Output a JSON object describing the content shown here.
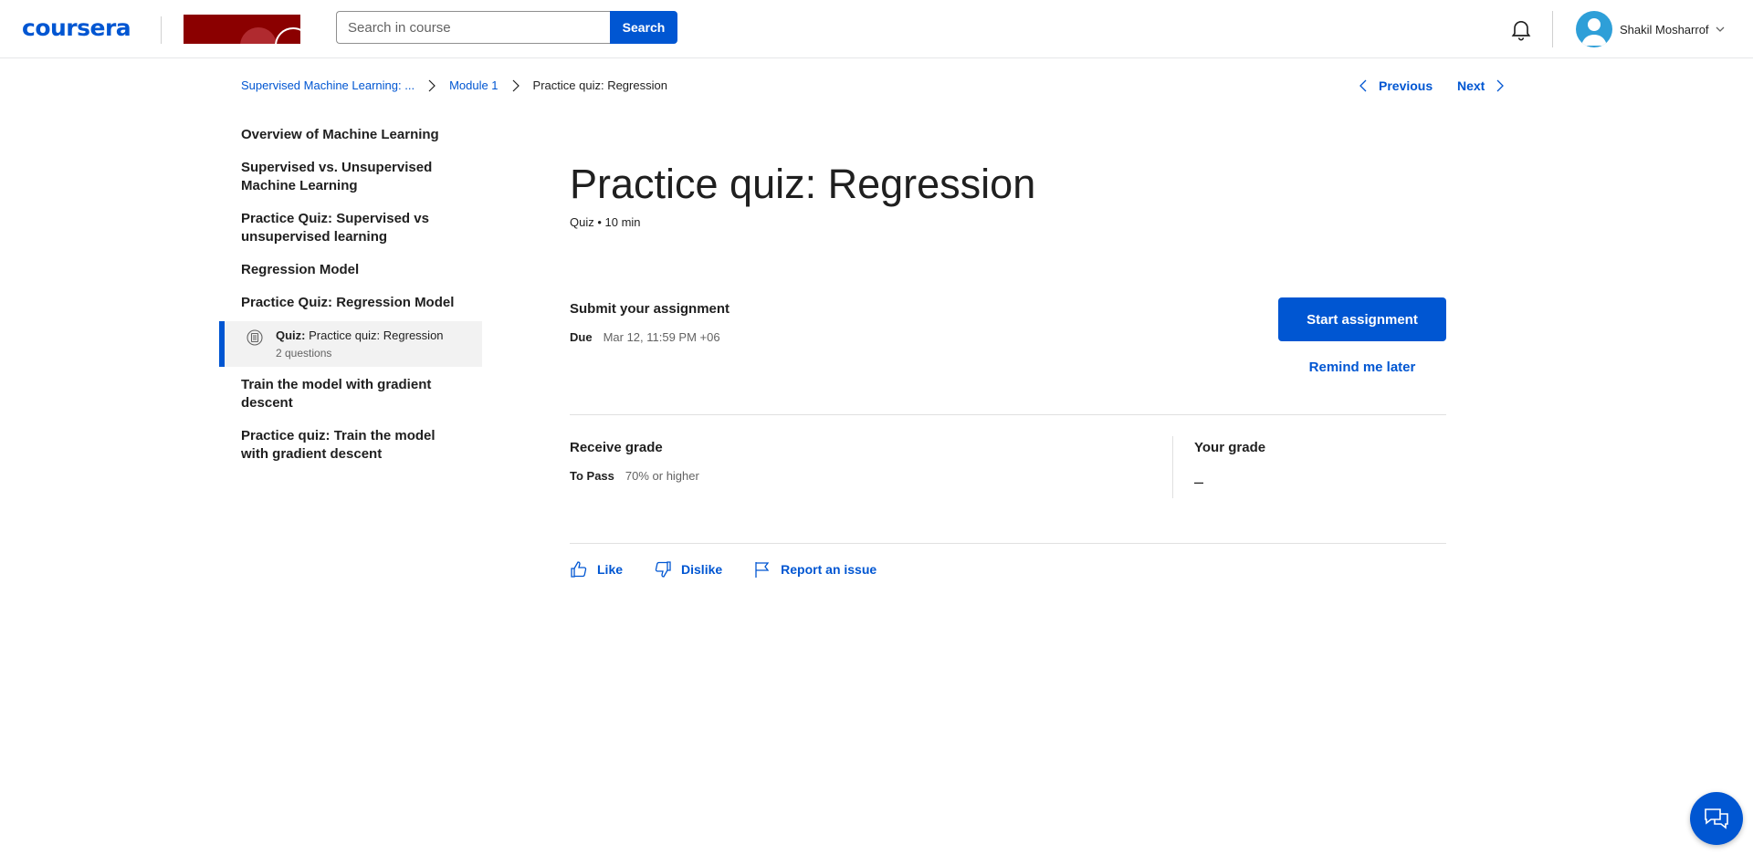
{
  "header": {
    "logo_text": "coursera",
    "search": {
      "placeholder": "Search in course",
      "value": ""
    },
    "search_button_label": "Search",
    "user_name": "Shakil Mosharrof",
    "brand_color": "#0056d2"
  },
  "breadcrumb": {
    "items": [
      "Supervised Machine Learning: ...",
      "Module 1"
    ],
    "current": "Practice quiz: Regression"
  },
  "nav": {
    "previous_label": "Previous",
    "next_label": "Next"
  },
  "sidebar": {
    "items": [
      {
        "label": "Overview of Machine Learning"
      },
      {
        "label": "Supervised vs. Unsupervised Machine Learning"
      },
      {
        "label": "Practice Quiz: Supervised vs unsupervised learning"
      },
      {
        "label": "Regression Model"
      },
      {
        "label": "Practice Quiz: Regression Model"
      }
    ],
    "active": {
      "type_label": "Quiz:",
      "title": "Practice quiz: Regression",
      "detail": "2 questions"
    },
    "items_after": [
      {
        "label": "Train the model with gradient descent"
      },
      {
        "label": "Practice quiz: Train the model with gradient descent"
      }
    ]
  },
  "main": {
    "title": "Practice quiz: Regression",
    "meta": "Quiz • 10 min",
    "submit": {
      "heading": "Submit your assignment",
      "due_label": "Due",
      "due_value": "Mar 12, 11:59 PM +06",
      "start_button": "Start assignment",
      "remind_button": "Remind me later"
    },
    "grade": {
      "heading": "Receive grade",
      "pass_label": "To Pass",
      "pass_value": "70% or higher",
      "your_grade_heading": "Your grade",
      "your_grade_value": "–"
    },
    "feedback": {
      "like": "Like",
      "dislike": "Dislike",
      "report": "Report an issue"
    }
  }
}
